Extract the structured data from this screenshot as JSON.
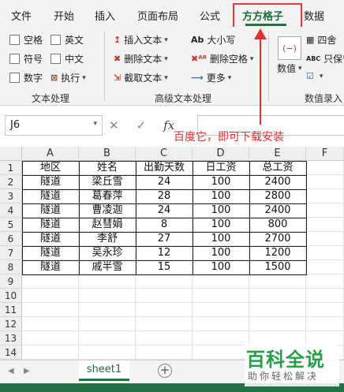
{
  "menu": {
    "tabs": [
      "文件",
      "开始",
      "插入",
      "页面布局",
      "公式",
      "方方格子",
      "数据"
    ],
    "active_tab": "方方格子"
  },
  "ribbon": {
    "text_group": {
      "label": "文本处理",
      "items": [
        "空格",
        "英文",
        "符号",
        "中文",
        "数字",
        "执行"
      ]
    },
    "advanced_group": {
      "label": "高级文本处理",
      "insert_text": "插入文本",
      "delete_text": "删除文本",
      "extract_text": "截取文本",
      "case": "大小写",
      "delete_spaces": "删除空格",
      "more": "更多"
    },
    "value_group": {
      "label": "数值录入",
      "value_button": "数值",
      "four_rules": "四舍",
      "keep_value": "只保留"
    }
  },
  "formula_bar": {
    "name_box": "J6",
    "fx": "fx",
    "cancel": "✕",
    "confirm": "✓"
  },
  "annotation": {
    "text": "百度它，即可下载安装",
    "color": "#e23030"
  },
  "grid": {
    "columns": [
      "A",
      "B",
      "C",
      "D",
      "E",
      "F"
    ],
    "rows": [
      "1",
      "2",
      "3",
      "4",
      "5",
      "6",
      "7",
      "8",
      "9",
      "10",
      "11",
      "12",
      "13",
      "14"
    ],
    "header": [
      "地区",
      "姓名",
      "出勤天数",
      "日工资",
      "总工资"
    ],
    "data": [
      [
        "隧道",
        "梁丘雪",
        "24",
        "100",
        "2400"
      ],
      [
        "隧道",
        "葛春萍",
        "28",
        "100",
        "2800"
      ],
      [
        "隧道",
        "曹凌迦",
        "24",
        "100",
        "2400"
      ],
      [
        "隧道",
        "赵彗娟",
        "8",
        "100",
        "800"
      ],
      [
        "隧道",
        "李舒",
        "27",
        "100",
        "2700"
      ],
      [
        "隧道",
        "吴永珍",
        "12",
        "100",
        "1200"
      ],
      [
        "隧道",
        "戚半雪",
        "15",
        "100",
        "1500"
      ]
    ]
  },
  "sheets": {
    "tabs": [
      "sheet1"
    ],
    "add": "+"
  },
  "watermark": {
    "title": "百科全说",
    "subtitle": "助你轻松解决"
  },
  "colors": {
    "accent": "#217346",
    "highlight": "#e8383d"
  }
}
